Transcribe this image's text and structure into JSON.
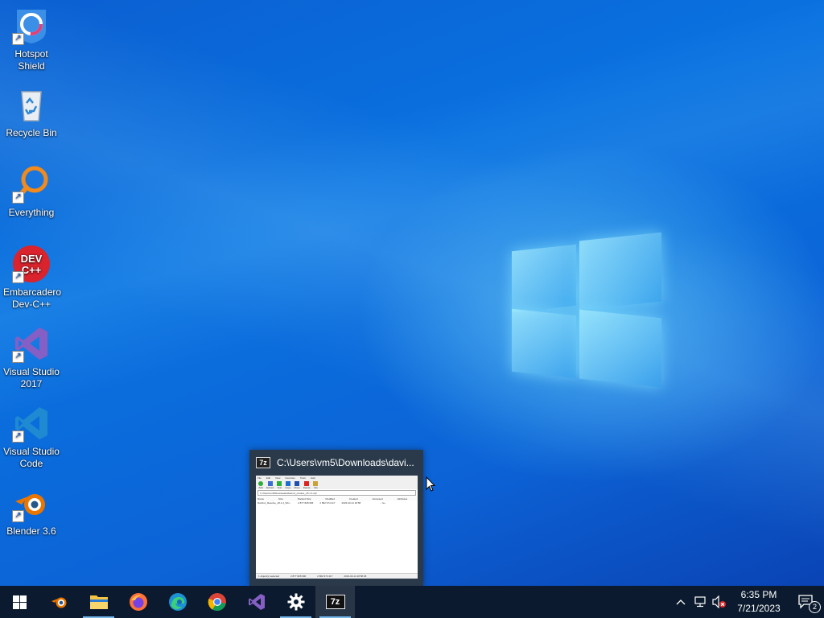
{
  "desktop": {
    "icons": [
      {
        "label": "Hotspot Shield",
        "icon": "hotspot-shield-icon",
        "shortcut": true
      },
      {
        "label": "Recycle Bin",
        "icon": "recycle-bin-icon",
        "shortcut": false
      },
      {
        "label": "Everything",
        "icon": "everything-search-icon",
        "shortcut": true
      },
      {
        "label": "Embarcadero Dev-C++",
        "icon": "dev-cpp-icon",
        "shortcut": true
      },
      {
        "label": "Visual Studio 2017",
        "icon": "visual-studio-icon",
        "shortcut": true
      },
      {
        "label": "Visual Studio Code",
        "icon": "vscode-icon",
        "shortcut": true
      },
      {
        "label": "Blender 3.6",
        "icon": "blender-icon",
        "shortcut": true
      }
    ]
  },
  "thumbnail": {
    "title": "C:\\Users\\vm5\\Downloads\\davi...",
    "app_icon_text": "7z",
    "preview": {
      "menu": [
        "File",
        "Edit",
        "View",
        "Favorites",
        "Tools",
        "Help"
      ],
      "toolbar": [
        "Add",
        "Extract",
        "Test",
        "Copy",
        "Move",
        "Delete",
        "Info"
      ],
      "address": "C:\\Users\\vm5\\Downloads\\davinci_resolve_18.1.4.zip\\",
      "columns": [
        "Name",
        "Size",
        "Packed Size",
        "Modified",
        "Created",
        "Accessed",
        "Attributes"
      ],
      "row": [
        "DaVinci_Resolve_18.1.4_Win...",
        "2 877 828 696",
        "2 862 974 417",
        "2023-03-14 18:58",
        "",
        "",
        "...rw..."
      ],
      "status": [
        "1 object(s) selected",
        "2 877 828 696",
        "2 862 974 417",
        "2023-03-14 18:58:48"
      ]
    }
  },
  "taskbar": {
    "start_icon": "windows-start-icon",
    "apps": [
      {
        "name": "blender",
        "icon": "blender-icon",
        "active": false
      },
      {
        "name": "file-explorer",
        "icon": "folder-icon",
        "active": true
      },
      {
        "name": "firefox",
        "icon": "firefox-icon",
        "active": false
      },
      {
        "name": "edge",
        "icon": "edge-icon",
        "active": false
      },
      {
        "name": "chrome",
        "icon": "chrome-icon",
        "active": false
      },
      {
        "name": "visual-studio",
        "icon": "visual-studio-icon",
        "active": false
      },
      {
        "name": "settings",
        "icon": "gear-icon",
        "active": true
      },
      {
        "name": "7-zip",
        "icon": "7zip-icon",
        "active": true,
        "label": "7z"
      }
    ],
    "tray": {
      "time": "6:35 PM",
      "date": "7/21/2023",
      "notification_count": "2"
    }
  },
  "colors": {
    "taskbar_bg": "#0b1a2e",
    "active_indicator": "#76b9ed",
    "desktop_bg": "#0a6fde"
  }
}
